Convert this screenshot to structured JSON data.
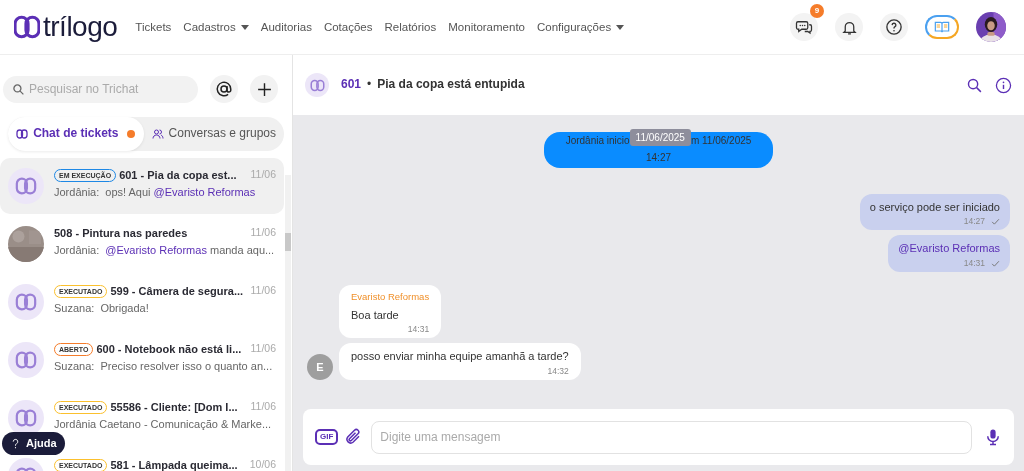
{
  "navbar": {
    "brand": "trílogo",
    "menu": [
      {
        "label": "Tickets",
        "dropdown": false
      },
      {
        "label": "Cadastros",
        "dropdown": true
      },
      {
        "label": "Auditorias",
        "dropdown": false
      },
      {
        "label": "Cotações",
        "dropdown": false
      },
      {
        "label": "Relatórios",
        "dropdown": false
      },
      {
        "label": "Monitoramento",
        "dropdown": false
      },
      {
        "label": "Configurações",
        "dropdown": true
      }
    ],
    "actions": [
      {
        "kind": "chat",
        "badge": "9"
      },
      {
        "kind": "bell"
      },
      {
        "kind": "help"
      },
      {
        "kind": "book"
      },
      {
        "kind": "avatar"
      }
    ]
  },
  "sidebar": {
    "search": {
      "placeholder": "Pesquisar no Trichat"
    },
    "tabs": [
      {
        "label": "Chat de tickets",
        "selected": true,
        "unread": true
      },
      {
        "label": "Conversas e grupos",
        "selected": false
      }
    ],
    "chats": [
      {
        "kind": "ticket",
        "status": "EM EXECUÇÃO",
        "color": "#1e88e5",
        "title": "601 - Pia da copa est...",
        "date": "11/06",
        "sender": "Jordânia:",
        "preview": [
          {
            "kind": "plain",
            "text": "ops! Aqui "
          },
          {
            "kind": "mention",
            "text": "@Evaristo Reformas"
          }
        ],
        "selected": true
      },
      {
        "title": "508 - Pintura nas paredes",
        "date": "11/06",
        "sender": "Jordânia:",
        "preview": [
          {
            "kind": "mention",
            "text": "@Evaristo Reformas"
          },
          {
            "kind": "plain",
            "text": " manda aqu..."
          }
        ],
        "selected": false
      },
      {
        "kind": "ticket",
        "status": "EXECUTADO",
        "color": "#fbc02d",
        "title": "599 - Câmera de segura...",
        "date": "11/06",
        "sender": "Suzana:",
        "preview": [
          {
            "kind": "plain",
            "text": "Obrigada!"
          }
        ],
        "selected": false
      },
      {
        "kind": "ticket",
        "status": "ABERTO",
        "color": "#f57c2a",
        "title": "600 - Notebook não está li...",
        "date": "11/06",
        "sender": "Suzana:",
        "preview": [
          {
            "kind": "plain",
            "text": "Preciso resolver isso o quanto an..."
          }
        ],
        "selected": false
      },
      {
        "kind": "ticket",
        "status": "EXECUTADO",
        "color": "#fbc02d",
        "title": "55586 - Cliente: [Dom I...",
        "date": "11/06",
        "preview": [
          {
            "kind": "plain",
            "text": "Jordânia Caetano - Comunicação & Marke..."
          }
        ],
        "selected": false
      },
      {
        "kind": "ticket",
        "status": "EXECUTADO",
        "color": "#fbc02d",
        "title": "581 - Lâmpada queima...",
        "date": "10/06",
        "selected": false
      }
    ],
    "help_button": "Ajuda"
  },
  "chat": {
    "header": {
      "number": "601",
      "separator": "•",
      "title": "Pia da copa está entupida"
    },
    "system_message": {
      "text_before": "Jordânia inicio",
      "date_chip": "11/06/2025",
      "text_after": "m 11/06/2025",
      "time": "14:27"
    },
    "messages": [
      {
        "kind": "outgoing",
        "parts": [
          {
            "kind": "plain",
            "text": "o serviço pode ser iniciado"
          }
        ],
        "time": "14:27"
      },
      {
        "kind": "outgoing",
        "parts": [
          {
            "kind": "mention",
            "text": "@Evaristo Reformas"
          }
        ],
        "time": "14:31"
      },
      {
        "kind": "incoming",
        "sender": "Evaristo Reformas",
        "parts": [
          {
            "kind": "plain",
            "text": "Boa tarde"
          }
        ],
        "time": "14:31"
      },
      {
        "kind": "incoming",
        "avatar": "E",
        "parts": [
          {
            "kind": "plain",
            "text": "posso enviar minha equipe amanhã a tarde?"
          }
        ],
        "time": "14:32"
      }
    ],
    "composer": {
      "placeholder": "Digite uma mensagem",
      "gif": "GIF"
    }
  }
}
